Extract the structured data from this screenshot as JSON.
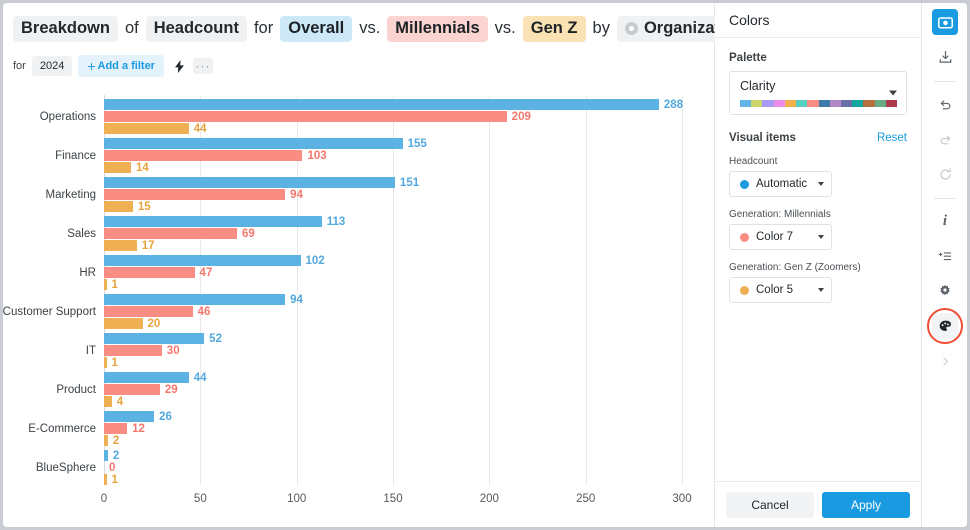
{
  "headline": {
    "parts": [
      {
        "text": "Breakdown",
        "style": "neutral",
        "name": "chip-breakdown"
      },
      {
        "text": "of",
        "style": "plain",
        "name": "word-of"
      },
      {
        "text": "Headcount",
        "style": "neutral",
        "name": "chip-headcount"
      },
      {
        "text": "for",
        "style": "plain",
        "name": "word-for"
      },
      {
        "text": "Overall",
        "style": "blue",
        "name": "chip-overall"
      },
      {
        "text": "vs.",
        "style": "plain",
        "name": "word-vs-1"
      },
      {
        "text": "Millennials",
        "style": "red",
        "name": "chip-millennials"
      },
      {
        "text": "vs.",
        "style": "plain",
        "name": "word-vs-2"
      },
      {
        "text": "Gen Z",
        "style": "amber",
        "name": "chip-genz"
      },
      {
        "text": "by",
        "style": "plain",
        "name": "word-by"
      }
    ],
    "group_by": "Organization"
  },
  "filters": {
    "for_label": "for",
    "year": "2024",
    "add_filter": "Add a filter",
    "add_filter_plus": "+",
    "bolt_icon": "lightning-bolt-icon",
    "more_icon": "···"
  },
  "chart_data": {
    "type": "bar",
    "orientation": "horizontal",
    "title": "Breakdown of Headcount for Overall vs. Millennials vs. Gen Z by Organization",
    "xlabel": "",
    "ylabel": "",
    "xlim": [
      0,
      300
    ],
    "ticks": [
      0,
      50,
      100,
      150,
      200,
      250,
      300
    ],
    "grid": true,
    "legend": "none",
    "categories": [
      "Operations",
      "Finance",
      "Marketing",
      "Sales",
      "HR",
      "Customer Support",
      "IT",
      "Product",
      "E-Commerce",
      "BlueSphere"
    ],
    "series": [
      {
        "name": "Overall",
        "color": "#5cb2e2",
        "values": [
          288,
          155,
          151,
          113,
          102,
          94,
          52,
          44,
          26,
          2
        ]
      },
      {
        "name": "Millennials",
        "color": "#fa8d83",
        "values": [
          209,
          103,
          94,
          69,
          47,
          46,
          30,
          29,
          12,
          0
        ]
      },
      {
        "name": "Gen Z",
        "color": "#eeb052",
        "values": [
          44,
          14,
          15,
          17,
          1,
          20,
          1,
          4,
          2,
          1
        ]
      }
    ]
  },
  "side": {
    "title": "Colors",
    "palette_label": "Palette",
    "palette_value": "Clarity",
    "palette_swatches": [
      "#63b6e5",
      "#cbd66a",
      "#a79cf5",
      "#eb8ce8",
      "#f0b14e",
      "#56cfc0",
      "#fa8d83",
      "#3d7ca8",
      "#b08ac4",
      "#6a6fa8",
      "#12a6a1",
      "#b4713d",
      "#68ab86",
      "#ac3c4c"
    ],
    "visual_items_label": "Visual items",
    "reset_label": "Reset",
    "items": [
      {
        "label": "Headcount",
        "value": "Automatic",
        "dot": "#1a9ae0",
        "name": "color-select-headcount"
      },
      {
        "label": "Generation: Millennials",
        "value": "Color 7",
        "dot": "#fa8d83",
        "name": "color-select-millennials"
      },
      {
        "label": "Generation: Gen Z (Zoomers)",
        "value": "Color 5",
        "dot": "#eeb052",
        "name": "color-select-genz"
      }
    ],
    "cancel_label": "Cancel",
    "apply_label": "Apply"
  },
  "rail": {
    "buttons": [
      {
        "name": "screenshot-icon",
        "glyph": "camera",
        "state": "active"
      },
      {
        "name": "download-icon",
        "glyph": "download",
        "state": "normal"
      },
      {
        "name": "separator-1",
        "glyph": "sep",
        "state": "sep"
      },
      {
        "name": "undo-icon",
        "glyph": "undo",
        "state": "normal"
      },
      {
        "name": "redo-icon",
        "glyph": "redo",
        "state": "muted"
      },
      {
        "name": "refresh-icon",
        "glyph": "refresh",
        "state": "muted"
      },
      {
        "name": "separator-2",
        "glyph": "sep",
        "state": "sep"
      },
      {
        "name": "info-icon",
        "glyph": "info",
        "state": "normal"
      },
      {
        "name": "add-to-list-icon",
        "glyph": "addlist",
        "state": "normal"
      },
      {
        "name": "settings-gear-icon",
        "glyph": "gear",
        "state": "normal"
      },
      {
        "name": "colors-palette-icon",
        "glyph": "palette",
        "state": "highlight"
      },
      {
        "name": "expand-chevron-icon",
        "glyph": "chevron",
        "state": "muted"
      }
    ]
  }
}
